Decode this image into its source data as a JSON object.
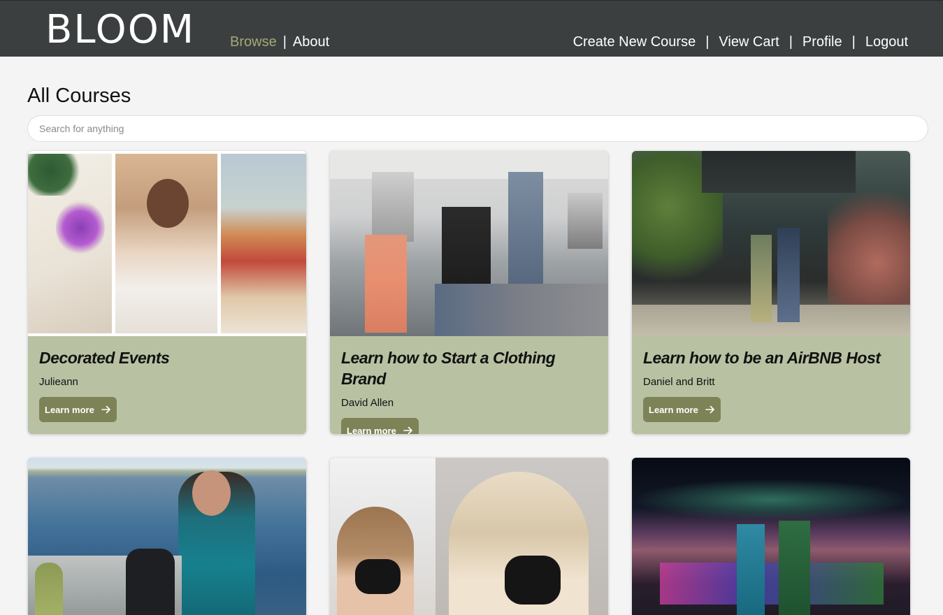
{
  "header": {
    "logo": "BLOOM",
    "nav_left": [
      {
        "label": "Browse",
        "active": true
      },
      {
        "label": "About",
        "active": false
      }
    ],
    "nav_right": [
      {
        "label": "Create New Course"
      },
      {
        "label": "View Cart"
      },
      {
        "label": "Profile"
      },
      {
        "label": "Logout"
      }
    ],
    "separator": "|"
  },
  "main": {
    "title": "All Courses",
    "search": {
      "placeholder": "Search for anything",
      "value": ""
    },
    "cards": [
      {
        "title": "Decorated Events",
        "author": "Julieann",
        "button": "Learn more"
      },
      {
        "title": "Learn how to Start a Clothing Brand",
        "author": "David Allen",
        "button": "Learn more"
      },
      {
        "title": "Learn how to be an AirBNB Host",
        "author": "Daniel and Britt",
        "button": "Learn more"
      },
      {
        "title": "",
        "author": "",
        "button": ""
      },
      {
        "title": "",
        "author": "",
        "button": ""
      },
      {
        "title": "",
        "author": "",
        "button": ""
      }
    ]
  },
  "colors": {
    "header_bg": "#3c3f3f",
    "accent": "#a4a877",
    "card_bg": "#b8c2a2",
    "button_bg": "#7e8357"
  }
}
